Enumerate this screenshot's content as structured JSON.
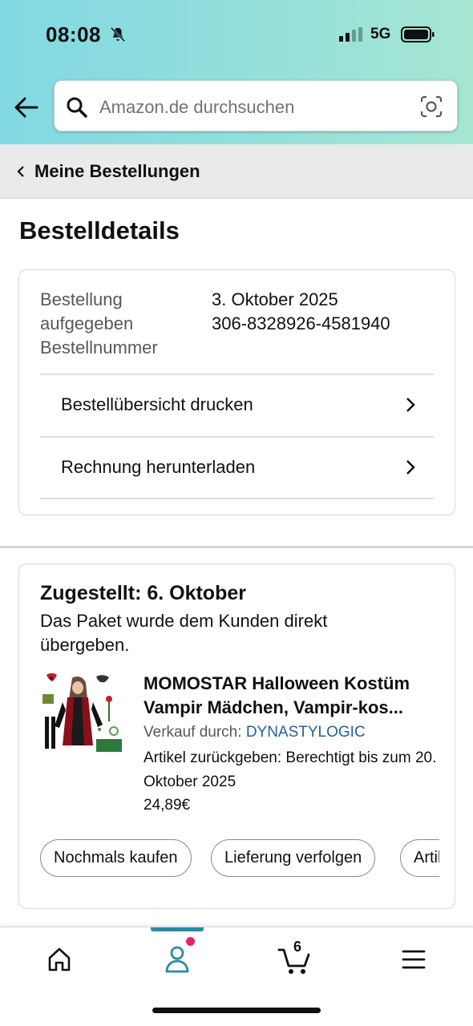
{
  "status_bar": {
    "time": "08:08",
    "network": "5G"
  },
  "search": {
    "placeholder": "Amazon.de durchsuchen"
  },
  "breadcrumb": {
    "label": "Meine Bestellungen"
  },
  "page": {
    "title": "Bestelldetails"
  },
  "order_info": {
    "placed_label": "Bestellung aufgegeben",
    "placed_value": "3. Oktober 2025",
    "number_label": "Bestellnummer",
    "number_value": "306-8328926-4581940",
    "links": [
      {
        "label": "Bestellübersicht drucken"
      },
      {
        "label": "Rechnung herunterladen"
      }
    ]
  },
  "delivery": {
    "status": "Zugestellt: 6. Oktober",
    "detail": "Das Paket wurde dem Kunden direkt übergeben.",
    "product": {
      "title": "MOMOSTAR Halloween Kostüm Vampir Mädchen, Vampir-kos...",
      "seller_prefix": "Verkauf durch:",
      "seller": "DYNASTYLOGIC",
      "return_info": "Artikel zurückgeben: Berechtigt bis zum 20. Oktober 2025",
      "price": "24,89€"
    },
    "actions": [
      {
        "label": "Nochmals kaufen"
      },
      {
        "label": "Lieferung verfolgen"
      },
      {
        "label": "Artikel zurückgeben"
      }
    ]
  },
  "tabbar": {
    "cart_count": "6",
    "active_tab": "account"
  },
  "colors": {
    "accent": "#2a8aa4",
    "link": "#2162a1",
    "badge": "#e2266c"
  }
}
